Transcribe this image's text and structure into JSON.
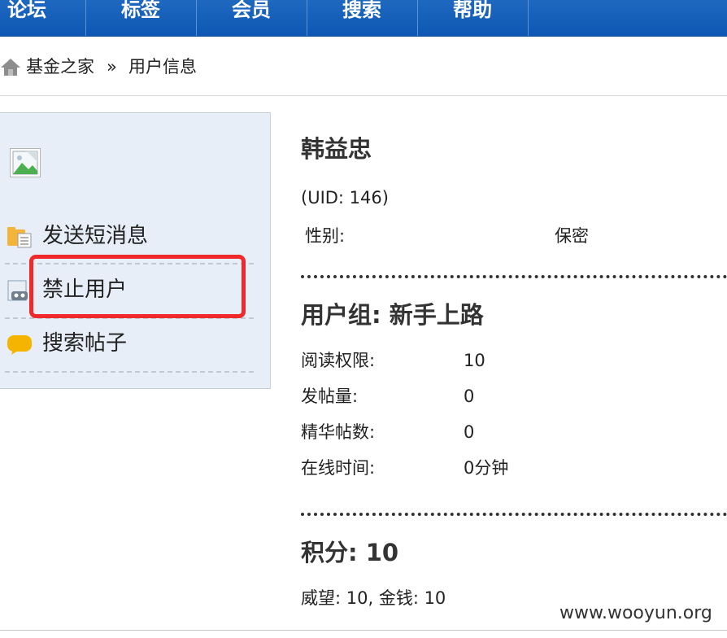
{
  "nav": {
    "items": [
      {
        "label": "论坛"
      },
      {
        "label": "标签"
      },
      {
        "label": "会员"
      },
      {
        "label": "搜索"
      },
      {
        "label": "帮助"
      }
    ]
  },
  "breadcrumb": {
    "root": "基金之家",
    "separator": "»",
    "current": "用户信息"
  },
  "sidebar": {
    "actions": [
      {
        "label": "发送短消息",
        "icon": "folder-message-icon"
      },
      {
        "label": "禁止用户",
        "icon": "ban-user-icon"
      },
      {
        "label": "搜索帖子",
        "icon": "speech-bubble-icon"
      }
    ]
  },
  "profile": {
    "name": "韩益忠",
    "uid": "(UID: 146)",
    "gender_label": "性别:",
    "gender_value": "保密"
  },
  "group": {
    "title": "用户组: 新手上路",
    "rows": [
      {
        "label": "阅读权限:",
        "value": "10"
      },
      {
        "label": "发帖量:",
        "value": "0"
      },
      {
        "label": "精华帖数:",
        "value": "0"
      },
      {
        "label": "在线时间:",
        "value": "0分钟"
      }
    ]
  },
  "credits": {
    "title": "积分: 10",
    "detail": "威望: 10, 金钱: 10"
  },
  "watermark": "www.wooyun.org",
  "colors": {
    "nav_bg": "#1565c0",
    "panel_bg": "#e7eef8",
    "highlight": "#f02a2a"
  }
}
